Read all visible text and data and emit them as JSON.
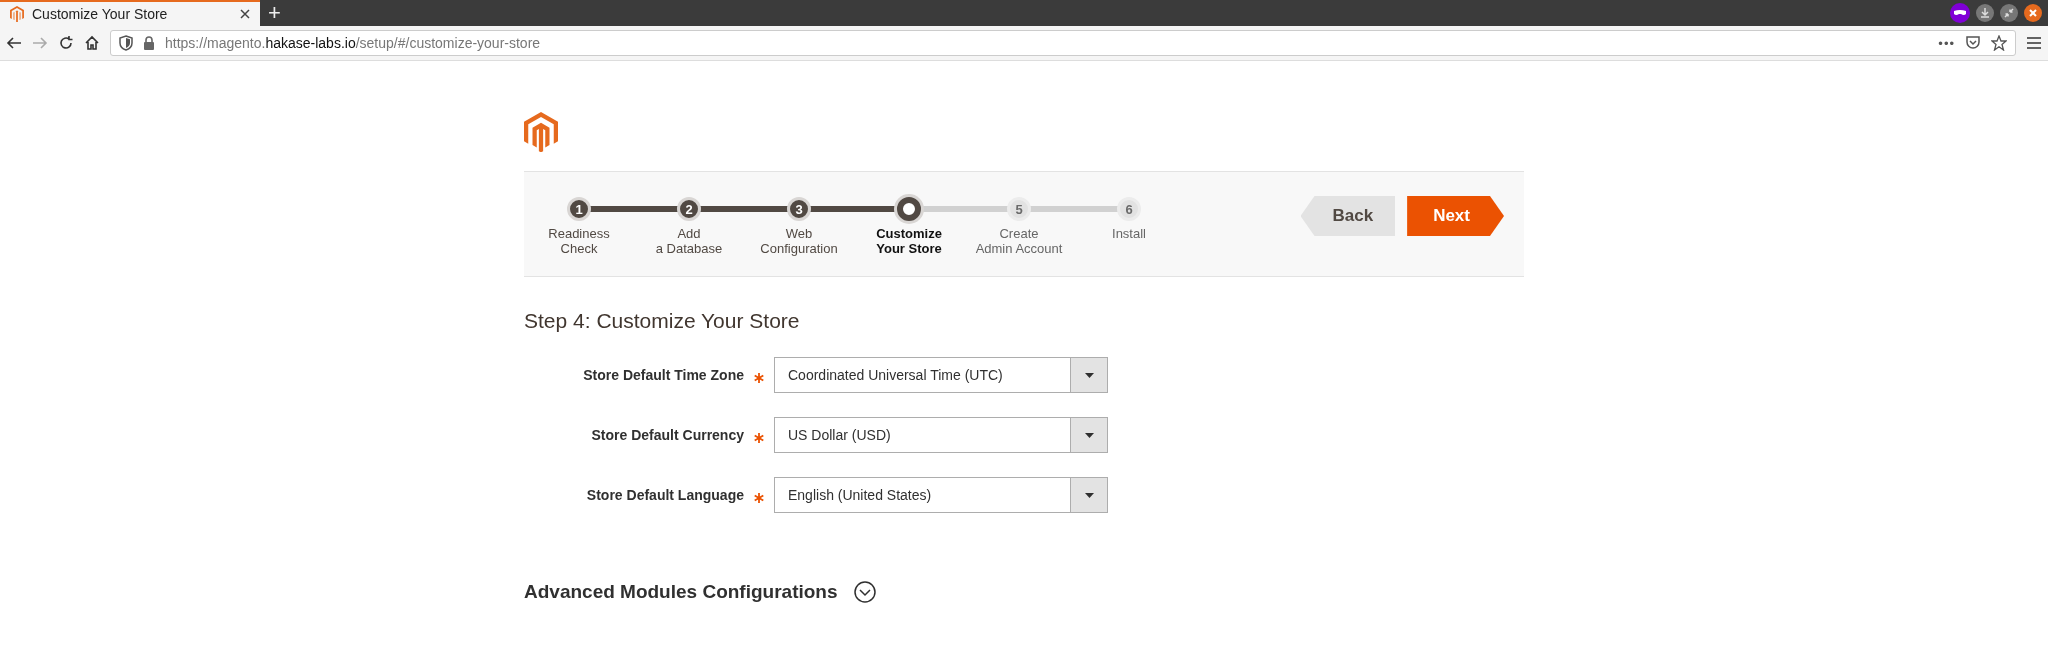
{
  "browser": {
    "tab": {
      "title": "Customize Your Store",
      "selected": true
    },
    "url": {
      "scheme": "https://magento.",
      "host": "hakase-labs.io",
      "path": "/setup/#/customize-your-store"
    },
    "page_actions": "•••",
    "new_tab": "+"
  },
  "wizard": {
    "steps": [
      {
        "number": "1",
        "label": [
          "Readiness",
          "Check"
        ],
        "done": true,
        "selected": false
      },
      {
        "number": "2",
        "label": [
          "Add",
          "a Database"
        ],
        "done": true,
        "selected": false
      },
      {
        "number": "3",
        "label": [
          "Web",
          "Configuration"
        ],
        "done": true,
        "selected": false
      },
      {
        "label": [
          "Customize",
          "Your Store"
        ],
        "done": false,
        "selected": true
      },
      {
        "number": "5",
        "label": [
          "Create",
          "Admin Account"
        ],
        "done": false,
        "selected": false
      },
      {
        "number": "6",
        "label": [
          "Install"
        ],
        "done": false,
        "selected": false
      }
    ],
    "buttons": [
      {
        "label": "Back",
        "kind": "back"
      },
      {
        "label": "Next",
        "kind": "next"
      }
    ]
  },
  "heading": "Step 4: Customize Your Store",
  "fields": [
    {
      "label": "Store Default Time Zone",
      "required": true,
      "value": "Coordinated Universal Time (UTC)"
    },
    {
      "label": "Store Default Currency",
      "required": true,
      "value": "US Dollar (USD)"
    },
    {
      "label": "Store Default Language",
      "required": true,
      "value": "English (United States)"
    }
  ],
  "advanced": {
    "title": "Advanced Modules Configurations",
    "expanded": false
  }
}
